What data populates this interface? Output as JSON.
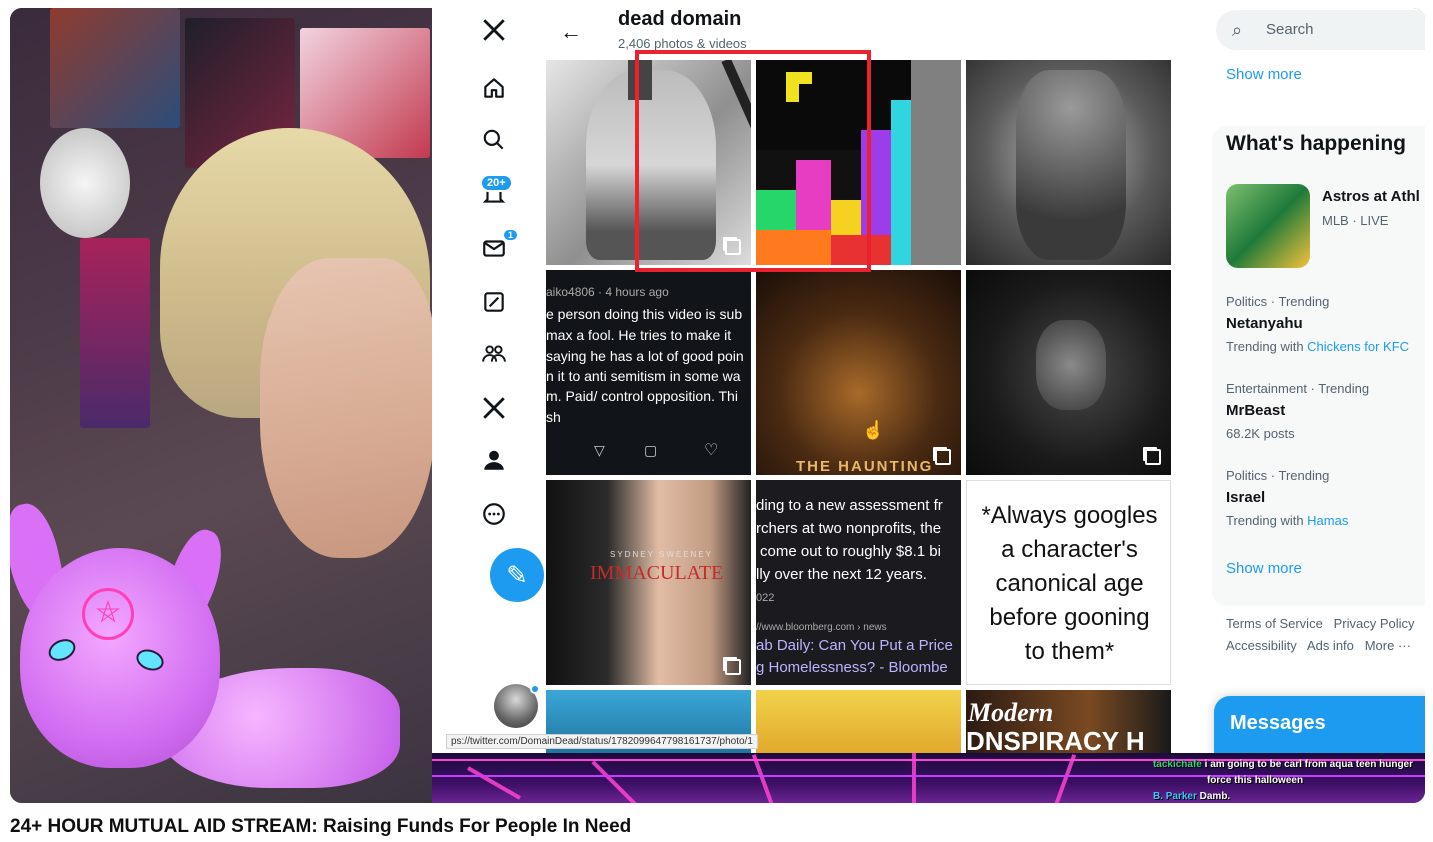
{
  "stream": {
    "title": "24+ HOUR MUTUAL AID STREAM: Raising Funds For People In Need"
  },
  "twitter": {
    "nav": {
      "notifications_badge": "20+",
      "messages_badge": "1",
      "icons": [
        "x-logo-icon",
        "home-icon",
        "search-icon",
        "notifications-icon",
        "messages-icon",
        "grok-icon",
        "communities-icon",
        "premium-icon",
        "profile-icon",
        "more-icon"
      ]
    },
    "header": {
      "name": "dead domain",
      "subtitle": "2,406 photos & videos"
    },
    "tiles": {
      "post_text_user": "aiko4806 · 4 hours ago",
      "post_text_lines": [
        "e person doing this video is sub",
        "max a fool. He tries to make it",
        "saying he has a lot of good poin",
        "n it to anti semitism in some wa",
        "m. Paid/ control opposition. Thi",
        "sh"
      ],
      "poster_small": "THE HAUNTING",
      "immaculate_title": "IMMACULATE",
      "immaculate_name": "SYDNEY SWEENEY",
      "news_lines": [
        "ding to a new assessment fr",
        "rchers at two nonprofits, the",
        "come out to roughly $8.1 bi",
        "lly over the next 12 years."
      ],
      "news_year": "022",
      "news_source": "//www.bloomberg.com › news",
      "news_headline_lines": [
        "ab Daily: Can You Put a Price",
        "g Homelessness? - Bloombe"
      ],
      "meme_lines": [
        "*Always googles",
        "a character's",
        "canonical age",
        "before gooning",
        "to them*"
      ],
      "bottom_tile_text": [
        "Modern",
        "DNSPIRACY H"
      ]
    },
    "status_url": "ps://twitter.com/DomainDead/status/1782099647798161737/photo/1",
    "sidebar": {
      "search_placeholder": "Search",
      "show_more_top": "Show more",
      "whats_happening": "What's happening",
      "top_trend_name": "Astros at Athl",
      "top_trend_meta": "MLB · LIVE",
      "trends": [
        {
          "meta": "Politics · Trending",
          "name": "Netanyahu",
          "extra_prefix": "Trending with ",
          "extra_link": "Chickens for KFC"
        },
        {
          "meta": "Entertainment · Trending",
          "name": "MrBeast",
          "extra_prefix": "68.2K posts",
          "extra_link": ""
        },
        {
          "meta": "Politics · Trending",
          "name": "Israel",
          "extra_prefix": "Trending with ",
          "extra_link": "Hamas"
        }
      ],
      "show_more_bottom": "Show more",
      "footer_line1": "Terms of Service   Privacy Policy",
      "footer_line2": "Accessibility   Ads info   More ···",
      "messages_label": "Messages"
    }
  },
  "chat": {
    "messages": [
      {
        "user": "tackichafe",
        "text": "i am going to be carl from aqua teen hunger"
      },
      {
        "user": "",
        "text": "force this halloween"
      },
      {
        "user": "B. Parker",
        "text": "Damb."
      }
    ]
  },
  "colors": {
    "twitter_blue": "#1d9bf0",
    "highlight_red": "#e8232f",
    "goat_pink": "#d36ff2"
  }
}
